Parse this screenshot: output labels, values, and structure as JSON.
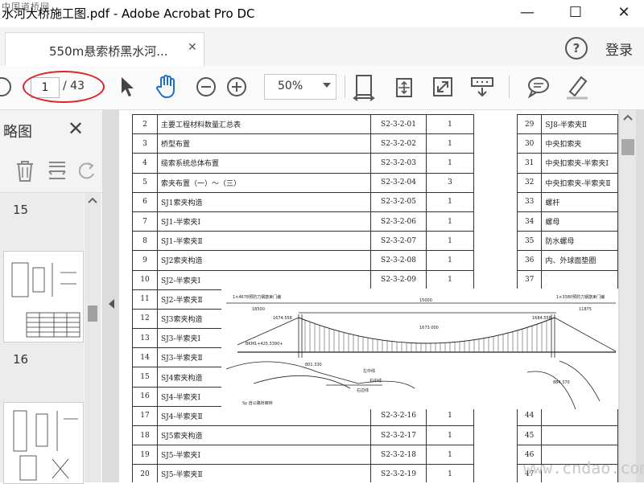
{
  "window": {
    "title": "水河大桥施工图.pdf - Adobe Acrobat Pro DC",
    "watermark_top": "中国道桥网",
    "minimize": "—",
    "maximize": "☐",
    "close": "✕"
  },
  "tabs": [
    {
      "label": "550m悬索桥黑水河...",
      "close": "✕"
    }
  ],
  "header": {
    "help": "?",
    "login": "登录"
  },
  "toolbar": {
    "page_current": "1",
    "page_total": "/ 43",
    "zoom": "50%",
    "icons": [
      "select-arrow-icon",
      "hand-icon",
      "zoom-out-icon",
      "zoom-in-icon",
      "fit-page-icon",
      "pan-zoom-icon",
      "fullscreen-icon",
      "read-mode-icon",
      "comment-icon",
      "highlight-pen-icon"
    ]
  },
  "sidebar": {
    "title": "略图",
    "close": "✕",
    "pages": [
      "15",
      "16"
    ]
  },
  "document": {
    "index_left": [
      {
        "n": "2",
        "name": "主要工程材料数量汇总表",
        "code": "S2-3-2-01",
        "q": "1"
      },
      {
        "n": "3",
        "name": "桥型布置",
        "code": "S2-3-2-02",
        "q": "1"
      },
      {
        "n": "4",
        "name": "缆索系统总体布置",
        "code": "S2-3-2-03",
        "q": "1"
      },
      {
        "n": "5",
        "name": "索夹布置（一）～（三）",
        "code": "S2-3-2-04",
        "q": "3"
      },
      {
        "n": "6",
        "name": "SJ1索夹构造",
        "code": "S2-3-2-05",
        "q": "1"
      },
      {
        "n": "7",
        "name": "SJ1-半索夹Ⅰ",
        "code": "S2-3-2-06",
        "q": "1"
      },
      {
        "n": "8",
        "name": "SJ1-半索夹Ⅱ",
        "code": "S2-3-2-07",
        "q": "1"
      },
      {
        "n": "9",
        "name": "SJ2索夹构造",
        "code": "S2-3-2-08",
        "q": "1"
      },
      {
        "n": "10",
        "name": "SJ2-半索夹Ⅰ",
        "code": "S2-3-2-09",
        "q": "1"
      },
      {
        "n": "11",
        "name": "SJ2-半索夹Ⅱ",
        "code": "",
        "q": ""
      },
      {
        "n": "12",
        "name": "SJ3索夹构造",
        "code": "",
        "q": ""
      },
      {
        "n": "13",
        "name": "SJ3-半索夹Ⅰ",
        "code": "",
        "q": ""
      },
      {
        "n": "14",
        "name": "SJ3-半索夹Ⅱ",
        "code": "",
        "q": ""
      },
      {
        "n": "15",
        "name": "SJ4索夹构造",
        "code": "",
        "q": ""
      },
      {
        "n": "16",
        "name": "SJ4-半索夹Ⅰ",
        "code": "",
        "q": ""
      },
      {
        "n": "17",
        "name": "SJ4-半索夹Ⅱ",
        "code": "S2-3-2-16",
        "q": "1"
      },
      {
        "n": "18",
        "name": "SJ5索夹构造",
        "code": "S2-3-2-17",
        "q": "1"
      },
      {
        "n": "19",
        "name": "SJ5-半索夹Ⅰ",
        "code": "S2-3-2-18",
        "q": "1"
      },
      {
        "n": "20",
        "name": "SJ5-半索夹Ⅱ",
        "code": "S2-3-2-19",
        "q": "1"
      }
    ],
    "index_right": [
      {
        "n": "29",
        "name": "SJ8-半索夹Ⅱ"
      },
      {
        "n": "30",
        "name": "中央扣索夹"
      },
      {
        "n": "31",
        "name": "中央扣索夹-半索夹Ⅰ"
      },
      {
        "n": "32",
        "name": "中央扣索夹-半索夹Ⅱ"
      },
      {
        "n": "33",
        "name": "螺杆"
      },
      {
        "n": "34",
        "name": "螺母"
      },
      {
        "n": "35",
        "name": "防水螺母"
      },
      {
        "n": "36",
        "name": "内、外球面垫圈"
      },
      {
        "n": "37",
        "name": ""
      },
      {
        "n": "",
        "name": ""
      },
      {
        "n": "",
        "name": ""
      },
      {
        "n": "",
        "name": ""
      },
      {
        "n": "",
        "name": ""
      },
      {
        "n": "",
        "name": ""
      },
      {
        "n": "",
        "name": ""
      },
      {
        "n": "44",
        "name": ""
      },
      {
        "n": "45",
        "name": ""
      },
      {
        "n": "46",
        "name": ""
      },
      {
        "n": "47",
        "name": ""
      }
    ],
    "drawing_labels": {
      "left_note": "1×4678预防力钢筋束门编",
      "right_note": "1×3380预防力钢筋束门编",
      "span_main": "15000",
      "span_left": "18500",
      "span_right": "11875",
      "left_elev": "1674.558",
      "right_elev": "1684.558",
      "center_elev": "1673.000",
      "pile_left": "BKM1+425.3390+",
      "water_left": "801.330",
      "road_a": "左中线",
      "road_b": "右中线",
      "road_c": "右边线",
      "bottom_left": "Sy 自公路桥廊桥",
      "bottom_right": "884.370"
    },
    "watermark": "www.cndao.com"
  }
}
